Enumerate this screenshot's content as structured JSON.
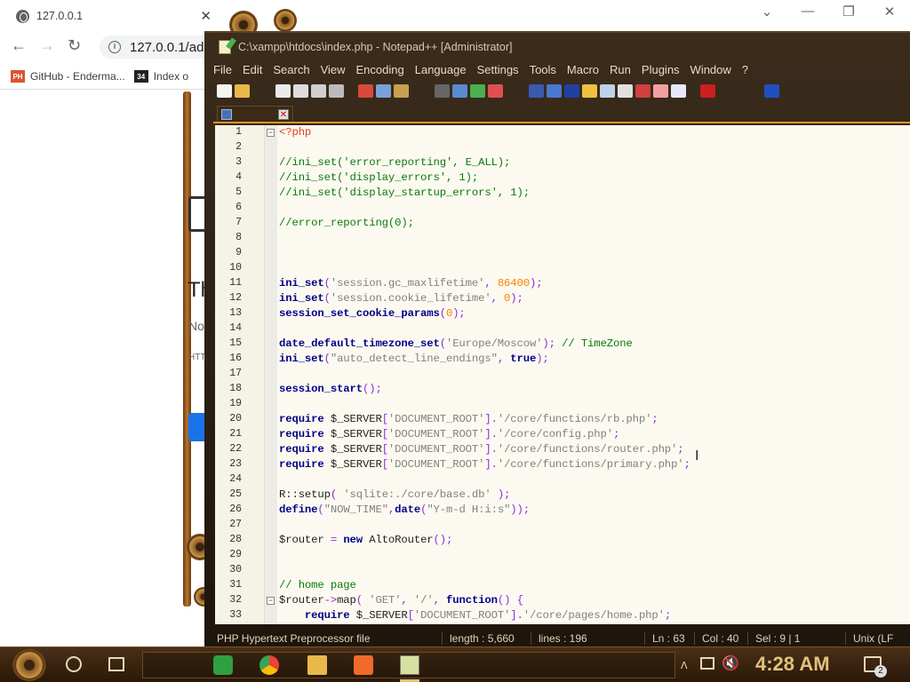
{
  "browser": {
    "tab_title": "127.0.0.1",
    "url": "127.0.0.1/adm",
    "bookmarks": [
      {
        "icon_text": "PH",
        "label": "GitHub - Enderma..."
      },
      {
        "icon_text": "34",
        "label": "Index o"
      }
    ],
    "page_fragments": {
      "heading": "Th",
      "subtext": "No",
      "small": "HTT"
    }
  },
  "notepad": {
    "title": "C:\\xampp\\htdocs\\index.php - Notepad++ [Administrator]",
    "menu": [
      "File",
      "Edit",
      "Search",
      "View",
      "Encoding",
      "Language",
      "Settings",
      "Tools",
      "Macro",
      "Run",
      "Plugins",
      "Window",
      "?"
    ],
    "tab_label": "",
    "lines": [
      {
        "n": "1",
        "fold": "minus",
        "segs": [
          {
            "t": "<?php",
            "c": "#e0411f"
          }
        ]
      },
      {
        "n": "2",
        "segs": []
      },
      {
        "n": "3",
        "segs": [
          {
            "t": "//ini_set('error_reporting', E_ALL);",
            "c": "#0a7a0a"
          }
        ]
      },
      {
        "n": "4",
        "segs": [
          {
            "t": "//ini_set('display_errors', 1);",
            "c": "#0a7a0a"
          }
        ]
      },
      {
        "n": "5",
        "segs": [
          {
            "t": "//ini_set('display_startup_errors', 1);",
            "c": "#0a7a0a"
          }
        ]
      },
      {
        "n": "6",
        "segs": []
      },
      {
        "n": "7",
        "segs": [
          {
            "t": "//error_reporting(0);",
            "c": "#0a7a0a"
          }
        ]
      },
      {
        "n": "8",
        "segs": []
      },
      {
        "n": "9",
        "segs": []
      },
      {
        "n": "10",
        "segs": []
      },
      {
        "n": "11",
        "segs": [
          {
            "t": "ini_set",
            "c": "#00008b",
            "b": true
          },
          {
            "t": "(",
            "c": "#8a2be2"
          },
          {
            "t": "'session.gc_maxlifetime'",
            "c": "#808080"
          },
          {
            "t": ", ",
            "c": "#8a2be2"
          },
          {
            "t": "86400",
            "c": "#ff8000"
          },
          {
            "t": ");",
            "c": "#8a2be2"
          }
        ]
      },
      {
        "n": "12",
        "segs": [
          {
            "t": "ini_set",
            "c": "#00008b",
            "b": true
          },
          {
            "t": "(",
            "c": "#8a2be2"
          },
          {
            "t": "'session.cookie_lifetime'",
            "c": "#808080"
          },
          {
            "t": ", ",
            "c": "#8a2be2"
          },
          {
            "t": "0",
            "c": "#ff8000"
          },
          {
            "t": ");",
            "c": "#8a2be2"
          }
        ]
      },
      {
        "n": "13",
        "segs": [
          {
            "t": "session_set_cookie_params",
            "c": "#00008b",
            "b": true
          },
          {
            "t": "(",
            "c": "#8a2be2"
          },
          {
            "t": "0",
            "c": "#ff8000"
          },
          {
            "t": ");",
            "c": "#8a2be2"
          }
        ]
      },
      {
        "n": "14",
        "segs": []
      },
      {
        "n": "15",
        "segs": [
          {
            "t": "date_default_timezone_set",
            "c": "#00008b",
            "b": true
          },
          {
            "t": "(",
            "c": "#8a2be2"
          },
          {
            "t": "'Europe/Moscow'",
            "c": "#808080"
          },
          {
            "t": "); ",
            "c": "#8a2be2"
          },
          {
            "t": "// TimeZone",
            "c": "#0a7a0a"
          }
        ]
      },
      {
        "n": "16",
        "segs": [
          {
            "t": "ini_set",
            "c": "#00008b",
            "b": true
          },
          {
            "t": "(",
            "c": "#8a2be2"
          },
          {
            "t": "\"auto_detect_line_endings\"",
            "c": "#808080"
          },
          {
            "t": ", ",
            "c": "#8a2be2"
          },
          {
            "t": "true",
            "c": "#00008b",
            "b": true
          },
          {
            "t": ");",
            "c": "#8a2be2"
          }
        ]
      },
      {
        "n": "17",
        "segs": []
      },
      {
        "n": "18",
        "segs": [
          {
            "t": "session_start",
            "c": "#00008b",
            "b": true
          },
          {
            "t": "();",
            "c": "#8a2be2"
          }
        ]
      },
      {
        "n": "19",
        "segs": []
      },
      {
        "n": "20",
        "segs": [
          {
            "t": "require ",
            "c": "#00008b",
            "b": true
          },
          {
            "t": "$_SERVER",
            "c": "#222"
          },
          {
            "t": "[",
            "c": "#8a2be2"
          },
          {
            "t": "'DOCUMENT_ROOT'",
            "c": "#808080"
          },
          {
            "t": "].",
            "c": "#8a2be2"
          },
          {
            "t": "'/core/functions/rb.php'",
            "c": "#808080"
          },
          {
            "t": ";",
            "c": "#8a2be2"
          }
        ]
      },
      {
        "n": "21",
        "segs": [
          {
            "t": "require ",
            "c": "#00008b",
            "b": true
          },
          {
            "t": "$_SERVER",
            "c": "#222"
          },
          {
            "t": "[",
            "c": "#8a2be2"
          },
          {
            "t": "'DOCUMENT_ROOT'",
            "c": "#808080"
          },
          {
            "t": "].",
            "c": "#8a2be2"
          },
          {
            "t": "'/core/config.php'",
            "c": "#808080"
          },
          {
            "t": ";",
            "c": "#8a2be2"
          }
        ]
      },
      {
        "n": "22",
        "segs": [
          {
            "t": "require ",
            "c": "#00008b",
            "b": true
          },
          {
            "t": "$_SERVER",
            "c": "#222"
          },
          {
            "t": "[",
            "c": "#8a2be2"
          },
          {
            "t": "'DOCUMENT_ROOT'",
            "c": "#808080"
          },
          {
            "t": "].",
            "c": "#8a2be2"
          },
          {
            "t": "'/core/functions/router.php'",
            "c": "#808080"
          },
          {
            "t": ";",
            "c": "#8a2be2"
          }
        ]
      },
      {
        "n": "23",
        "segs": [
          {
            "t": "require ",
            "c": "#00008b",
            "b": true
          },
          {
            "t": "$_SERVER",
            "c": "#222"
          },
          {
            "t": "[",
            "c": "#8a2be2"
          },
          {
            "t": "'DOCUMENT_ROOT'",
            "c": "#808080"
          },
          {
            "t": "].",
            "c": "#8a2be2"
          },
          {
            "t": "'/core/functions/primary.php'",
            "c": "#808080"
          },
          {
            "t": ";",
            "c": "#8a2be2"
          }
        ]
      },
      {
        "n": "24",
        "segs": []
      },
      {
        "n": "25",
        "segs": [
          {
            "t": "R::setup",
            "c": "#222"
          },
          {
            "t": "( ",
            "c": "#8a2be2"
          },
          {
            "t": "'sqlite:./core/base.db'",
            "c": "#808080"
          },
          {
            "t": " );",
            "c": "#8a2be2"
          }
        ]
      },
      {
        "n": "26",
        "segs": [
          {
            "t": "define",
            "c": "#00008b",
            "b": true
          },
          {
            "t": "(",
            "c": "#8a2be2"
          },
          {
            "t": "\"NOW_TIME\"",
            "c": "#808080"
          },
          {
            "t": ",",
            "c": "#8a2be2"
          },
          {
            "t": "date",
            "c": "#00008b",
            "b": true
          },
          {
            "t": "(",
            "c": "#8a2be2"
          },
          {
            "t": "\"Y-m-d H:i:s\"",
            "c": "#808080"
          },
          {
            "t": "));",
            "c": "#8a2be2"
          }
        ]
      },
      {
        "n": "27",
        "segs": []
      },
      {
        "n": "28",
        "segs": [
          {
            "t": "$router",
            "c": "#222"
          },
          {
            "t": " = ",
            "c": "#8a2be2"
          },
          {
            "t": "new ",
            "c": "#00008b",
            "b": true
          },
          {
            "t": "AltoRouter",
            "c": "#222"
          },
          {
            "t": "();",
            "c": "#8a2be2"
          }
        ]
      },
      {
        "n": "29",
        "segs": []
      },
      {
        "n": "30",
        "segs": []
      },
      {
        "n": "31",
        "segs": [
          {
            "t": "// home page",
            "c": "#0a7a0a"
          }
        ]
      },
      {
        "n": "32",
        "fold": "minus",
        "segs": [
          {
            "t": "$router",
            "c": "#222"
          },
          {
            "t": "->",
            "c": "#8a2be2"
          },
          {
            "t": "map",
            "c": "#222"
          },
          {
            "t": "( ",
            "c": "#8a2be2"
          },
          {
            "t": "'GET'",
            "c": "#808080"
          },
          {
            "t": ", ",
            "c": "#8a2be2"
          },
          {
            "t": "'/'",
            "c": "#808080"
          },
          {
            "t": ", ",
            "c": "#8a2be2"
          },
          {
            "t": "function",
            "c": "#00008b",
            "b": true
          },
          {
            "t": "() {",
            "c": "#8a2be2"
          }
        ]
      },
      {
        "n": "33",
        "segs": [
          {
            "t": "    require ",
            "c": "#00008b",
            "b": true
          },
          {
            "t": "$_SERVER",
            "c": "#222"
          },
          {
            "t": "[",
            "c": "#8a2be2"
          },
          {
            "t": "'DOCUMENT_ROOT'",
            "c": "#808080"
          },
          {
            "t": "].",
            "c": "#8a2be2"
          },
          {
            "t": "'/core/pages/home.php'",
            "c": "#808080"
          },
          {
            "t": ";",
            "c": "#8a2be2"
          }
        ]
      }
    ],
    "status": {
      "filetype": "PHP Hypertext Preprocessor file",
      "length": "length : 5,660",
      "lines": "lines : 196",
      "ln": "Ln : 63",
      "col": "Col : 40",
      "sel": "Sel : 9 | 1",
      "eol": "Unix (LF"
    }
  },
  "taskbar": {
    "clock": "4:28 AM",
    "notification_count": "2"
  }
}
